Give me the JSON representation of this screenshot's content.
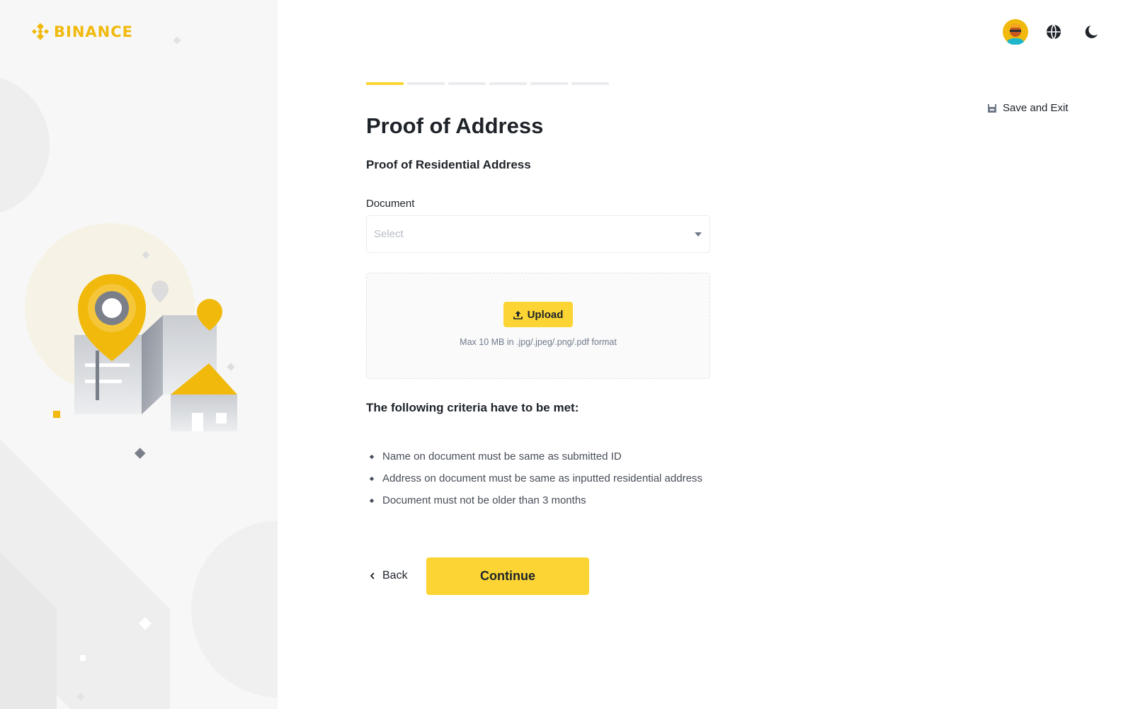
{
  "brand": {
    "name": "BINANCE",
    "color": "#f0b90b"
  },
  "header": {
    "icons": [
      "avatar",
      "globe-icon",
      "moon-icon"
    ]
  },
  "progress": {
    "total_steps": 6,
    "current_step": 1,
    "active_color": "#fcd535"
  },
  "save_exit": {
    "label": "Save and Exit",
    "icon": "save-icon"
  },
  "page": {
    "title": "Proof of Address",
    "section_title": "Proof of Residential Address"
  },
  "document_field": {
    "label": "Document",
    "placeholder": "Select",
    "icon": "caret-down-icon"
  },
  "upload": {
    "button_label": "Upload",
    "hint": "Max 10 MB in .jpg/.jpeg/.png/.pdf format",
    "icon": "upload-icon"
  },
  "criteria": {
    "title": "The following criteria have to be met:",
    "items": [
      "Name on document must be same as submitted ID",
      "Address on document must be same as inputted residential address",
      "Document must not be older than 3 months"
    ]
  },
  "actions": {
    "back_label": "Back",
    "continue_label": "Continue"
  }
}
